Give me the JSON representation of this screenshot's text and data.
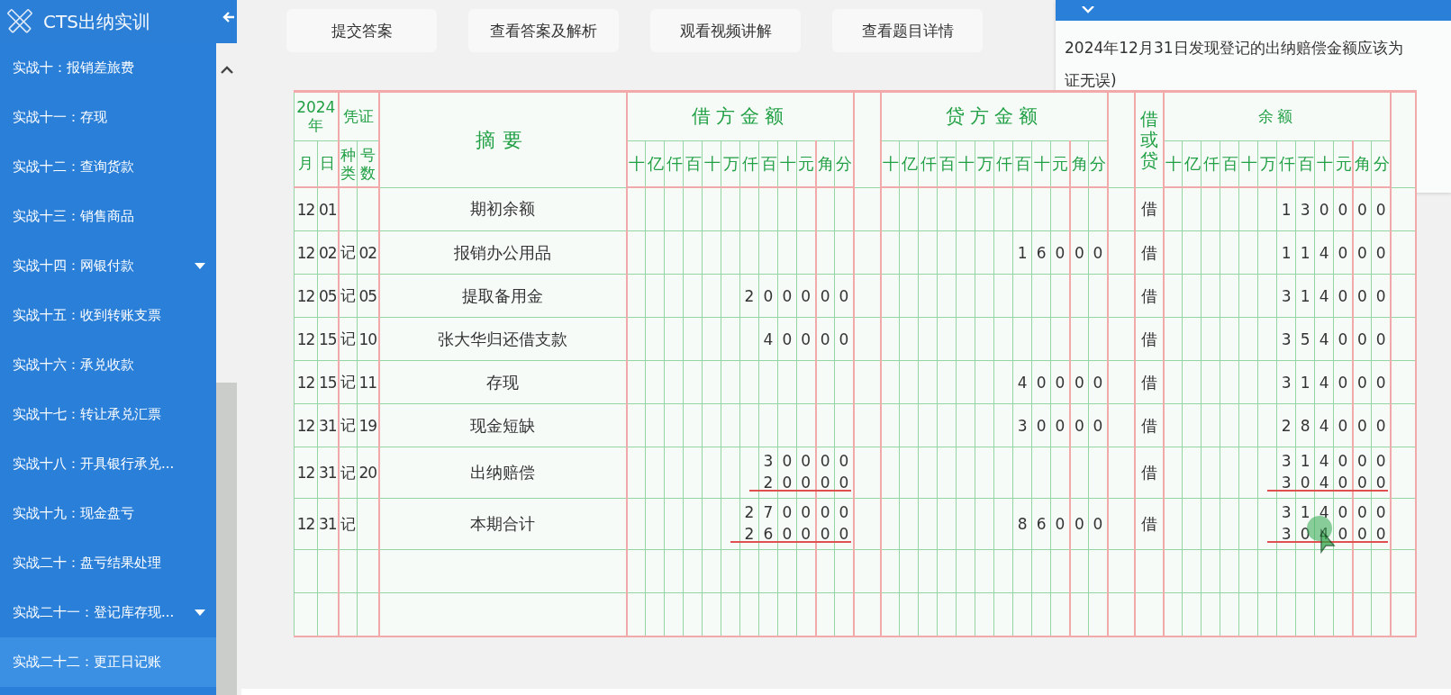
{
  "sidebar": {
    "title": "CTS出纳实训",
    "items": [
      {
        "label": "实战十：报销差旅费",
        "selected": false,
        "expandable": false
      },
      {
        "label": "实战十一：存现",
        "selected": false,
        "expandable": false
      },
      {
        "label": "实战十二：查询货款",
        "selected": false,
        "expandable": false
      },
      {
        "label": "实战十三：销售商品",
        "selected": false,
        "expandable": false
      },
      {
        "label": "实战十四：网银付款",
        "selected": false,
        "expandable": true
      },
      {
        "label": "实战十五：收到转账支票",
        "selected": false,
        "expandable": false
      },
      {
        "label": "实战十六：承兑收款",
        "selected": false,
        "expandable": false
      },
      {
        "label": "实战十七：转让承兑汇票",
        "selected": false,
        "expandable": false
      },
      {
        "label": "实战十八：开具银行承兑...",
        "selected": false,
        "expandable": false
      },
      {
        "label": "实战十九：现金盘亏",
        "selected": false,
        "expandable": false
      },
      {
        "label": "实战二十：盘亏结果处理",
        "selected": false,
        "expandable": false
      },
      {
        "label": "实战二十一：登记库存现...",
        "selected": false,
        "expandable": true
      },
      {
        "label": "实战二十二：更正日记账",
        "selected": true,
        "expandable": false
      }
    ]
  },
  "toolbar": {
    "buttons": [
      "提交答案",
      "查看答案及解析",
      "观看视频讲解",
      "查看题目详情"
    ]
  },
  "question_panel": {
    "lines": [
      "2024年12月31日发现登记的出纳赔偿金额应该为",
      "证无误)"
    ]
  },
  "ledger": {
    "year": "2024年",
    "voucher": "凭证",
    "summary": "摘要",
    "month": "月",
    "day": "日",
    "kind": "种类",
    "number": "号数",
    "debit": {
      "title": "借方金额",
      "units": [
        "十",
        "亿",
        "仟",
        "百",
        "十",
        "万",
        "仟",
        "百",
        "十",
        "元",
        "角",
        "分"
      ]
    },
    "credit": {
      "title": "贷方金额",
      "units": [
        "十",
        "亿",
        "仟",
        "百",
        "十",
        "万",
        "仟",
        "百",
        "十",
        "元",
        "角",
        "分"
      ]
    },
    "dc": "借或贷",
    "balance": {
      "title": "余额",
      "units": [
        "十",
        "亿",
        "仟",
        "百",
        "十",
        "万",
        "仟",
        "百",
        "十",
        "元",
        "角",
        "分"
      ]
    },
    "rows": [
      {
        "month": "12",
        "day": "01",
        "summary": "期初余额",
        "dc": "借",
        "balance": {
          "value": [
            "1",
            "3",
            "0",
            "0",
            "0",
            "0"
          ]
        }
      },
      {
        "month": "12",
        "day": "02",
        "kind": "记",
        "number": "02",
        "summary": "报销办公用品",
        "credit": {
          "value": [
            "1",
            "6",
            "0",
            "0",
            "0"
          ]
        },
        "dc": "借",
        "balance": {
          "value": [
            "1",
            "1",
            "4",
            "0",
            "0",
            "0"
          ]
        }
      },
      {
        "month": "12",
        "day": "05",
        "kind": "记",
        "number": "05",
        "summary": "提取备用金",
        "debit": {
          "value": [
            "2",
            "0",
            "0",
            "0",
            "0",
            "0"
          ]
        },
        "dc": "借",
        "balance": {
          "value": [
            "3",
            "1",
            "4",
            "0",
            "0",
            "0"
          ]
        }
      },
      {
        "month": "12",
        "day": "15",
        "kind": "记",
        "number": "10",
        "summary": "张大华归还借支款",
        "debit": {
          "value": [
            "4",
            "0",
            "0",
            "0",
            "0"
          ]
        },
        "dc": "借",
        "balance": {
          "value": [
            "3",
            "5",
            "4",
            "0",
            "0",
            "0"
          ]
        }
      },
      {
        "month": "12",
        "day": "15",
        "kind": "记",
        "number": "11",
        "summary": "存现",
        "credit": {
          "value": [
            "4",
            "0",
            "0",
            "0",
            "0"
          ]
        },
        "dc": "借",
        "balance": {
          "value": [
            "3",
            "1",
            "4",
            "0",
            "0",
            "0"
          ]
        }
      },
      {
        "month": "12",
        "day": "31",
        "kind": "记",
        "number": "19",
        "summary": "现金短缺",
        "credit": {
          "value": [
            "3",
            "0",
            "0",
            "0",
            "0"
          ]
        },
        "dc": "借",
        "balance": {
          "value": [
            "2",
            "8",
            "4",
            "0",
            "0",
            "0"
          ]
        }
      },
      {
        "month": "12",
        "day": "31",
        "kind": "记",
        "number": "20",
        "summary": "出纳赔偿",
        "debit": {
          "value": [
            "3",
            "0",
            "0",
            "0",
            "0"
          ],
          "struck": [
            "2",
            "0",
            "0",
            "0",
            "0"
          ]
        },
        "dc": "借",
        "balance": {
          "value": [
            "3",
            "1",
            "4",
            "0",
            "0",
            "0"
          ],
          "struck": [
            "3",
            "0",
            "4",
            "0",
            "0",
            "0"
          ]
        }
      },
      {
        "month": "12",
        "day": "31",
        "kind": "记",
        "summary": "本期合计",
        "debit": {
          "value": [
            "2",
            "7",
            "0",
            "0",
            "0",
            "0"
          ],
          "struck": [
            "2",
            "6",
            "0",
            "0",
            "0",
            "0"
          ]
        },
        "credit": {
          "value": [
            "8",
            "6",
            "0",
            "0",
            "0"
          ]
        },
        "dc": "借",
        "balance": {
          "value": [
            "3",
            "1",
            "4",
            "0",
            "0",
            "0"
          ],
          "struck": [
            "3",
            "0",
            "4",
            "0",
            "0",
            "0"
          ]
        }
      }
    ]
  }
}
